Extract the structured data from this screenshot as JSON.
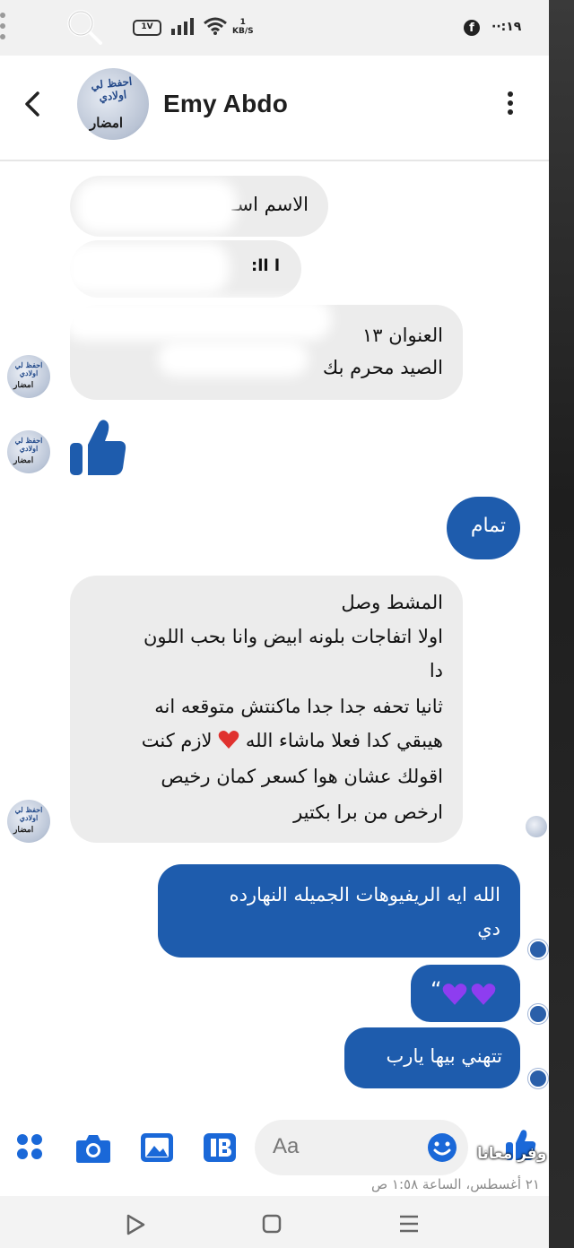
{
  "status_bar": {
    "battery_label": "1V",
    "speed_top": "1",
    "speed_unit": "KB/S",
    "time": "··:١٩"
  },
  "header": {
    "contact_name": "Emy Abdo",
    "avatar_logo_text": "احفظ لي اولادي",
    "avatar_brand": "امضار"
  },
  "messages": {
    "m1_line1": "الاسم اسـ",
    "m1_line2": "ا اا:",
    "m2_line1": "العنوان ١٣",
    "m2_line2": "الصيد محرم بك",
    "m3_text": "تمام",
    "m4_lines": [
      "المشط وصل",
      "اولا اتفاجات بلونه ابيض وانا بحب اللون",
      "دا",
      "ثانيا تحفه جدا جدا ماكنتش متوقعه انه",
      "لازم كنت",
      "هيبقي كدا فعلا ماشاء الله",
      "اقولك عشان هوا كسعر كمان رخيص",
      "ارخص من برا بكتير"
    ],
    "m5_lines": [
      "الله ايه الريفيوهات الجميله النهارده",
      "دي"
    ],
    "m6_text": "“",
    "m7_text": "تتهني بيها يارب"
  },
  "composer": {
    "placeholder": "Aa"
  },
  "overlays": {
    "date_text": "٢١ أغسطس، الساعة ١:٥٨ ص",
    "brand_text": "وفر معانا"
  },
  "colors": {
    "outgoing_bubble": "#1e5cad",
    "incoming_bubble": "#ececec",
    "accent": "#1a68d8",
    "heart_red": "#e0322f",
    "heart_purple": "#8e3df0"
  }
}
